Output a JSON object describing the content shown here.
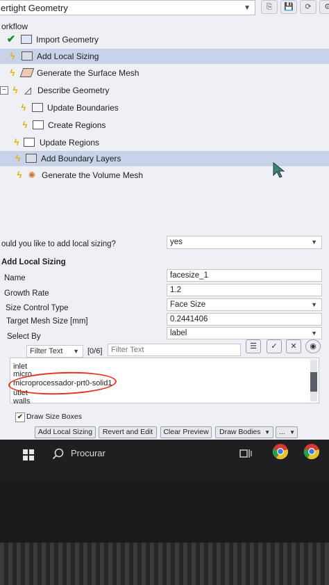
{
  "header": {
    "workflow_select_value": "ertight Geometry",
    "workflow_label": "orkflow"
  },
  "tree": {
    "items": [
      {
        "label": "Import Geometry"
      },
      {
        "label": "Add Local Sizing"
      },
      {
        "label": "Generate the Surface Mesh"
      },
      {
        "label": "Describe Geometry"
      },
      {
        "label": "Update Boundaries"
      },
      {
        "label": "Create Regions"
      },
      {
        "label": "Update Regions"
      },
      {
        "label": "Add Boundary Layers"
      },
      {
        "label": "Generate the Volume Mesh"
      }
    ]
  },
  "form": {
    "question": "ould you like to add local sizing?",
    "question_value": "yes",
    "section_title": "Add Local Sizing",
    "name_label": "Name",
    "name_value": "facesize_1",
    "growth_rate_label": "Growth Rate",
    "growth_rate_value": "1.2",
    "size_control_label": "Size Control Type",
    "size_control_value": "Face Size",
    "target_mesh_label": "Target Mesh Size [mm]",
    "target_mesh_value": "0.2441406",
    "select_by_label": "Select By",
    "select_by_value": "label",
    "filter_type": "Filter Text",
    "filter_count": "[0/6]",
    "filter_placeholder": "Filter Text",
    "list": [
      "inlet",
      "micro",
      "microprocessador-prt0-solid1",
      "utlet",
      "walls"
    ],
    "draw_boxes_label": "Draw Size Boxes",
    "buttons": {
      "add": "Add Local Sizing",
      "revert": "Revert and Edit",
      "clear": "Clear Preview",
      "draw": "Draw Bodies",
      "more": "..."
    }
  },
  "taskbar": {
    "search_text": "Procurar"
  },
  "colors": {
    "selection": "#c8d3ea",
    "annotation": "#e4331d",
    "bolt": "#e0b000"
  }
}
